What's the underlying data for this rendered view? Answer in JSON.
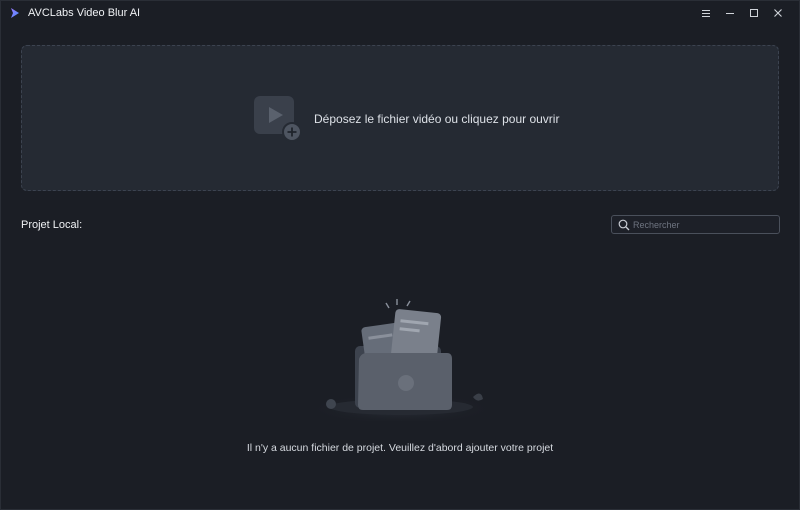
{
  "window": {
    "title": "AVCLabs Video Blur AI",
    "logo_icon": "avclabs-logo-icon",
    "controls": [
      "menu-icon",
      "minimize-icon",
      "maximize-icon",
      "close-icon"
    ]
  },
  "dropzone": {
    "label": "Déposez le fichier vidéo ou cliquez pour ouvrir",
    "icon": "add-video-icon"
  },
  "local_projects": {
    "title": "Projet Local:",
    "search": {
      "value": "",
      "placeholder": "Rechercher",
      "icon": "search-icon"
    },
    "empty_message": "Il n'y a aucun fichier de projet. Veuillez d'abord ajouter votre projet",
    "empty_icon": "empty-folder-illustration"
  },
  "colors": {
    "background": "#1b1e25",
    "panel": "#252a33",
    "accent_purple": "#7b6cf6",
    "accent_blue": "#4a8cff"
  }
}
